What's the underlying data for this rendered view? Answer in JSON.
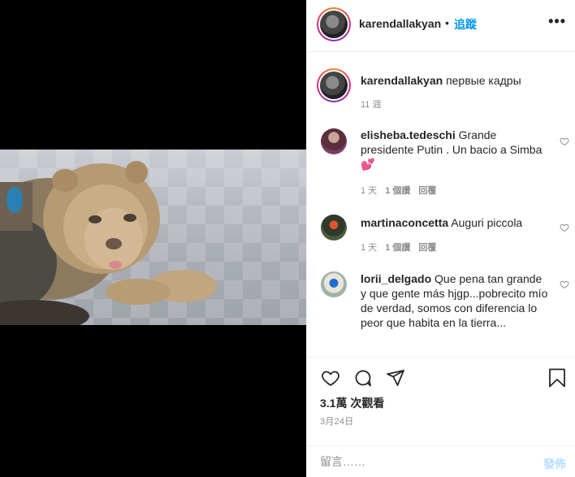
{
  "header": {
    "username": "karendallakyan",
    "separator": "•",
    "follow_label": "追蹤",
    "more_icon": "more-horizontal-icon",
    "more_glyph": "•••"
  },
  "caption": {
    "username": "karendallakyan",
    "text": "первые кадры",
    "age": "11 週"
  },
  "comments": [
    {
      "username": "elisheba.tedeschi",
      "text": "Grande presidente Putin . Un bacio a Simba 💕",
      "age": "1 天",
      "likes": "1 個讚",
      "reply": "回覆"
    },
    {
      "username": "martinaconcetta",
      "text": "Auguri piccola",
      "age": "1 天",
      "likes": "1 個讚",
      "reply": "回覆"
    },
    {
      "username": "lorii_delgado",
      "text": "Que pena tan grande y que gente más hjgp...pobrecito mío de verdad, somos con diferencia lo peor que habita en la tierra..."
    }
  ],
  "stats": {
    "views_count": "3.1萬",
    "views_label": "次觀看",
    "date": "3月24日"
  },
  "comment_box": {
    "placeholder": "留言……",
    "post_label": "發佈"
  },
  "colors": {
    "link": "#0095f6",
    "post_disabled": "#b2dffc",
    "muted": "#8e8e8e",
    "text": "#262626"
  }
}
